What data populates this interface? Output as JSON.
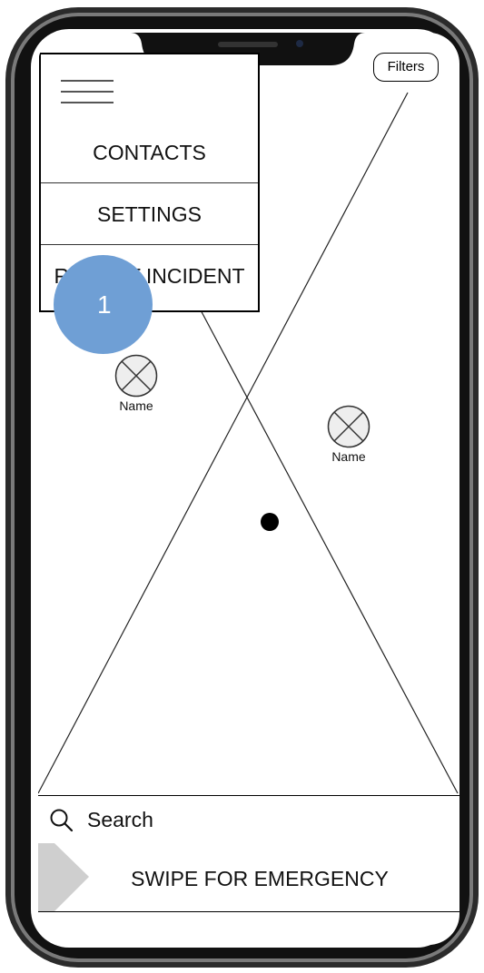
{
  "toolbar": {
    "filters_label": "Filters"
  },
  "menu": {
    "items": [
      {
        "label": "CONTACTS"
      },
      {
        "label": "SETTINGS"
      },
      {
        "label": "REPORT INCIDENT"
      }
    ]
  },
  "annotation": {
    "number": "1"
  },
  "map": {
    "pins": [
      {
        "label": "Name"
      },
      {
        "label": "Name"
      }
    ]
  },
  "search": {
    "label": "Search"
  },
  "emergency": {
    "label": "SWIPE FOR EMERGENCY"
  },
  "colors": {
    "badge": "#6f9fd5",
    "frame": "#1a1a1a",
    "swipe_handle": "#cfcfcf"
  }
}
